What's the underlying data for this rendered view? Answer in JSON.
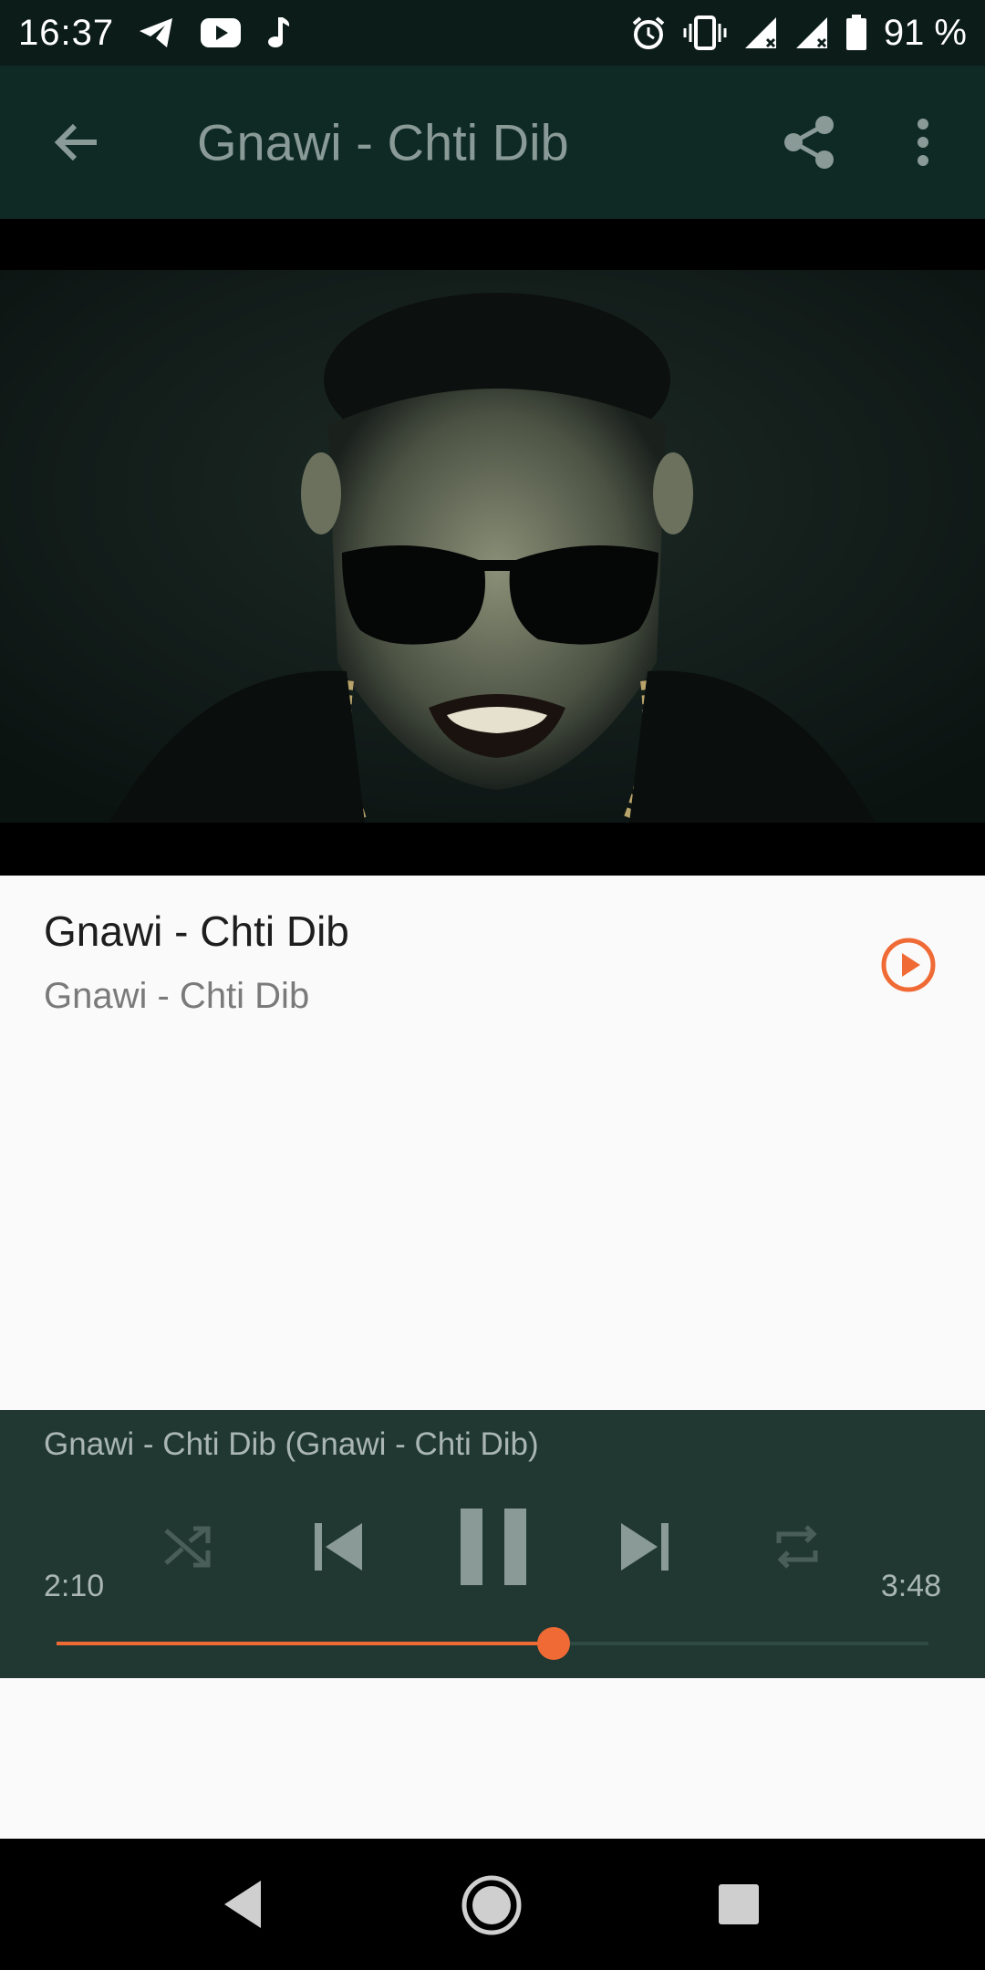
{
  "status_bar": {
    "time": "16:37",
    "battery": "91 %",
    "left_icons": [
      "telegram-icon",
      "youtube-icon",
      "music-note-icon"
    ],
    "right_icons": [
      "alarm-icon",
      "vibrate-icon",
      "signal-icon",
      "signal-icon",
      "battery-icon"
    ]
  },
  "app_bar": {
    "title": "Gnawi - Chti Dib",
    "back_icon": "arrow-left-icon",
    "share_icon": "share-icon",
    "more_icon": "more-vert-icon",
    "background": "#0f2a24"
  },
  "track": {
    "title": "Gnawi - Chti Dib",
    "subtitle": "Gnawi - Chti Dib",
    "play_icon": "play-circle-icon",
    "accent": "#f06a35"
  },
  "player": {
    "now_playing": "Gnawi - Chti Dib (Gnawi - Chti Dib)",
    "elapsed": "2:10",
    "total": "3:48",
    "progress_fraction": 0.57,
    "controls": [
      "shuffle-icon",
      "skip-previous-icon",
      "pause-icon",
      "skip-next-icon",
      "repeat-icon"
    ],
    "background": "#213832"
  },
  "nav_bar": {
    "icons": [
      "nav-back-icon",
      "nav-home-icon",
      "nav-recents-icon"
    ]
  }
}
